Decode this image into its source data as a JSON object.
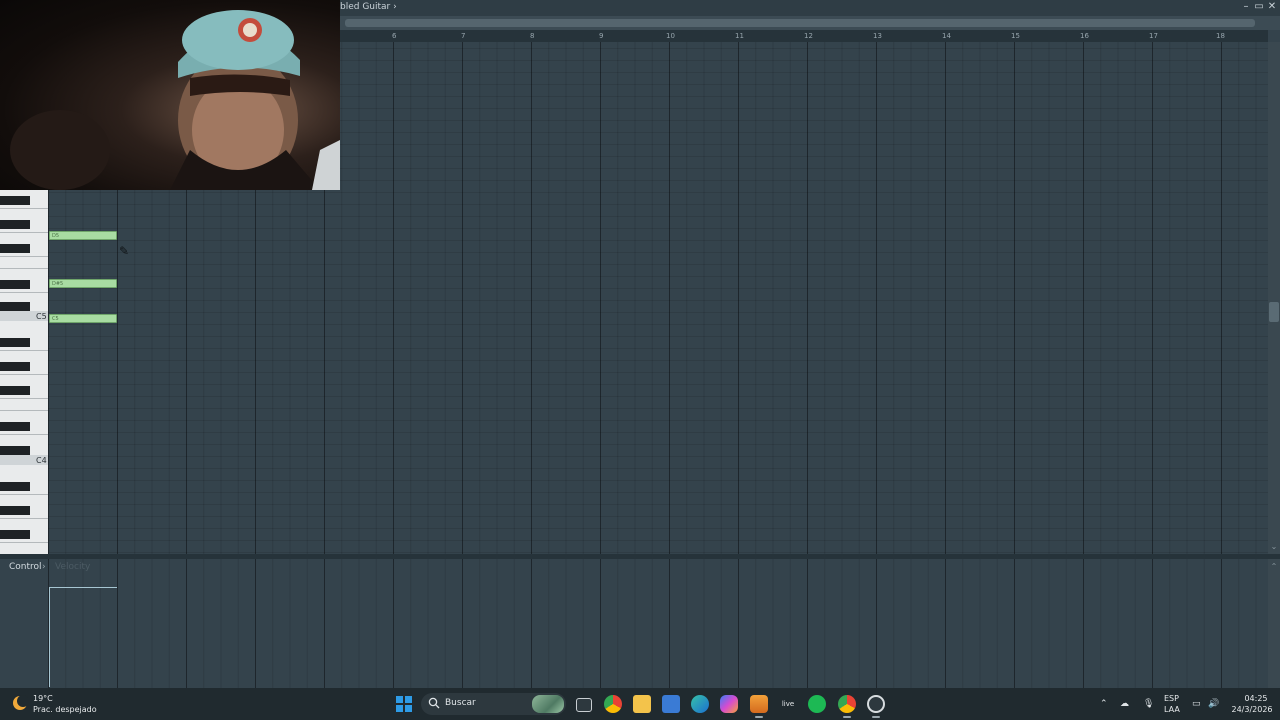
{
  "window": {
    "title": "bled Guitar",
    "title_arrow": "›",
    "controls": {
      "minimize": "–",
      "maximize": "▭",
      "close": "✕"
    }
  },
  "ruler": {
    "bars": [
      "6",
      "7",
      "8",
      "9",
      "10",
      "11",
      "12",
      "13",
      "14",
      "15",
      "16",
      "17",
      "18"
    ]
  },
  "keyboard": {
    "octave_labels": [
      "C5",
      "C4"
    ]
  },
  "notes": [
    {
      "label": "D5"
    },
    {
      "label": "D#5"
    },
    {
      "label": "C5"
    }
  ],
  "control_panel": {
    "label": "Control",
    "arrow": "›",
    "sub_label": "Velocity"
  },
  "taskbar": {
    "weather": {
      "temp": "19°C",
      "desc": "Prac. despejado"
    },
    "search": {
      "label": "Buscar"
    },
    "apps": [
      "task-view",
      "chrome",
      "file-explorer",
      "store",
      "edge",
      "copilot",
      "fl-studio",
      "live",
      "spotify",
      "chrome-profile",
      "obs"
    ],
    "live_label": "live",
    "language": {
      "line1": "ESP",
      "line2": "LAA"
    },
    "clock": {
      "time": "04:25",
      "date": "24/3/2026"
    }
  },
  "colors": {
    "grid_bg": "#34434c",
    "note_fill": "#a8dca2",
    "taskbar_bg": "#202a2f",
    "accent_blue": "#2e9be6"
  }
}
